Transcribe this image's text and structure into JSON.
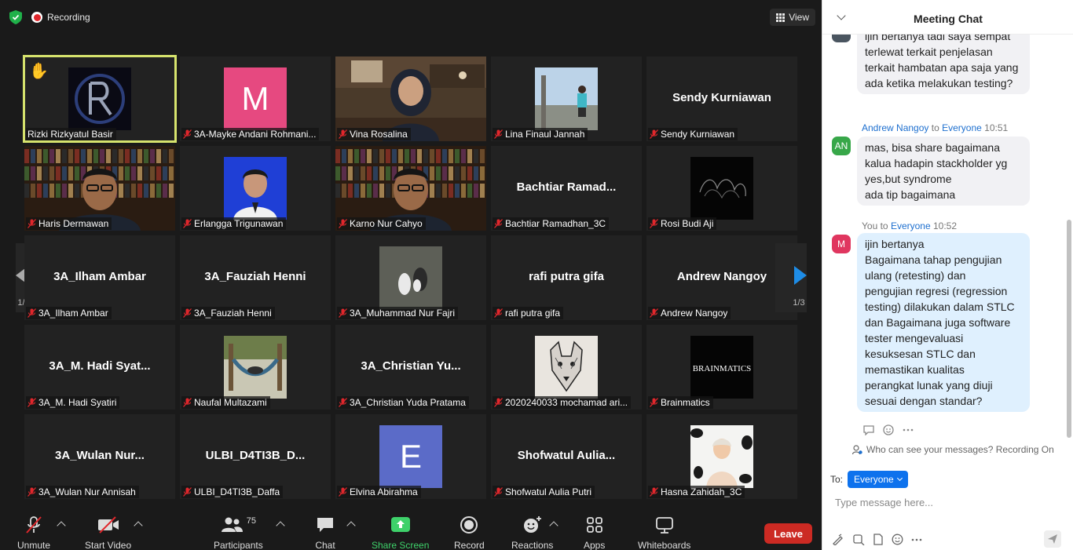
{
  "topbar": {
    "recording_label": "Recording",
    "view_label": "View"
  },
  "tiles": [
    {
      "display": "image",
      "name": "Rizki Rizkyatul Basir",
      "active": true,
      "hand": true,
      "pic_style": "logo"
    },
    {
      "display": "letter",
      "name": "3A-Mayke Andani Rohmani...",
      "letter": "M",
      "color": "#e64980"
    },
    {
      "display": "video",
      "name": "Vina Rosalina",
      "pic_style": "office"
    },
    {
      "display": "image",
      "name": "Lina Finaul Jannah",
      "pic_style": "outdoor"
    },
    {
      "display": "text",
      "name": "Sendy Kurniawan",
      "big": "Sendy Kurniawan"
    },
    {
      "display": "video",
      "name": "Haris Dermawan",
      "pic_style": "library"
    },
    {
      "display": "image",
      "name": "Erlangga Trigunawan",
      "pic_style": "bluebg"
    },
    {
      "display": "video",
      "name": "Karno Nur Cahyo",
      "pic_style": "library"
    },
    {
      "display": "text",
      "name": "Bachtiar Ramadhan_3C",
      "big": "Bachtiar  Ramad..."
    },
    {
      "display": "image",
      "name": "Rosi Budi Aji",
      "pic_style": "dark"
    },
    {
      "display": "text",
      "name": "3A_Ilham Ambar",
      "big": "3A_Ilham Ambar"
    },
    {
      "display": "text",
      "name": "3A_Fauziah Henni",
      "big": "3A_Fauziah Henni"
    },
    {
      "display": "image",
      "name": "3A_Muhammad Nur Fajri",
      "pic_style": "shoes"
    },
    {
      "display": "text",
      "name": "rafi putra gifa",
      "big": "rafi putra gifa"
    },
    {
      "display": "text",
      "name": "Andrew Nangoy",
      "big": "Andrew Nangoy"
    },
    {
      "display": "text",
      "name": "3A_M. Hadi Syatiri",
      "big": "3A_M.  Hadi Syat..."
    },
    {
      "display": "image",
      "name": "Naufal Multazami",
      "pic_style": "hammock"
    },
    {
      "display": "text",
      "name": "3A_Christian Yuda Pratama",
      "big": "3A_Christian  Yu..."
    },
    {
      "display": "image",
      "name": "2020240033 mochamad ari...",
      "pic_style": "wolf"
    },
    {
      "display": "image",
      "name": "Brainmatics",
      "pic_style": "brand",
      "brand_text": "BRAINMATICS"
    },
    {
      "display": "text",
      "name": "3A_Wulan Nur Annisah",
      "big": "3A_Wulan  Nur..."
    },
    {
      "display": "text",
      "name": "ULBI_D4TI3B_Daffa",
      "big": "ULBI_D4TI3B_D..."
    },
    {
      "display": "letter",
      "name": "Elvina Abirahma",
      "letter": "E",
      "color": "#5b6bc8"
    },
    {
      "display": "text",
      "name": "Shofwatul Aulia Putri",
      "big": "Shofwatul  Aulia..."
    },
    {
      "display": "image",
      "name": "Hasna Zahidah_3C",
      "pic_style": "cow"
    }
  ],
  "pager": {
    "left_label": "1/3",
    "right_label": "1/3"
  },
  "toolbar": {
    "unmute": "Unmute",
    "start_video": "Start Video",
    "participants": "Participants",
    "participants_count": "75",
    "chat": "Chat",
    "share_screen": "Share Screen",
    "record": "Record",
    "reactions": "Reactions",
    "apps": "Apps",
    "whiteboards": "Whiteboards",
    "leave": "Leave"
  },
  "chat": {
    "title": "Meeting Chat",
    "msg1": {
      "text": "ijin bertanya tadi saya sempat terlewat terkait penjelasan terkait hambatan apa saja yang ada ketika melakukan testing?"
    },
    "msg2": {
      "sender": "Andrew Nangoy",
      "to_word": "to",
      "recipient": "Everyone",
      "time": "10:51",
      "avatar": "AN",
      "avatar_color": "#37a749",
      "lines": [
        "mas, bisa share bagaimana",
        "kalua hadapin stackholder yg",
        "yes,but syndrome",
        "ada tip bagaimana"
      ]
    },
    "msg3": {
      "sender": "You",
      "to_word": "to",
      "recipient": "Everyone",
      "time": "10:52",
      "avatar": "M",
      "avatar_color": "#e0365f",
      "lines": [
        "ijin bertanya",
        "Bagaimana tahap pengujian",
        "ulang (retesting) dan",
        "pengujian regresi (regression",
        "testing) dilakukan dalam STLC",
        "dan Bagaimana juga software",
        "tester mengevaluasi",
        "kesuksesan STLC dan",
        "memastikan kualitas",
        "perangkat lunak yang diuji",
        "sesuai dengan standar?"
      ]
    },
    "who_can_see": "Who can see your messages? Recording On",
    "to_label": "To:",
    "to_value": "Everyone",
    "placeholder": "Type message here..."
  }
}
